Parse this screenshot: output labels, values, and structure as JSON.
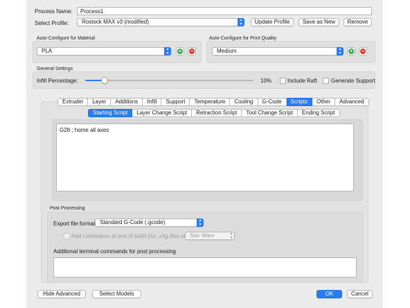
{
  "header": {
    "process_name_label": "Process Name:",
    "process_name_value": "Process1",
    "select_profile_label": "Select Profile:",
    "profile_value": "Rostock MAX v3 (modified)",
    "update_profile": "Update Profile",
    "save_as_new": "Save as New",
    "remove": "Remove"
  },
  "material": {
    "title": "Auto-Configure for Material",
    "value": "PLA"
  },
  "quality": {
    "title": "Auto-Configure for Print Quality",
    "value": "Medium"
  },
  "general": {
    "title": "General Settings",
    "infill_label": "Infill Percentage:",
    "infill_value_text": "10%",
    "infill_fraction": 0.1,
    "include_raft": "Include Raft",
    "generate_support": "Generate Support"
  },
  "tabs": [
    "Extruder",
    "Layer",
    "Additions",
    "Infill",
    "Support",
    "Temperature",
    "Cooling",
    "G-Code",
    "Scripts",
    "Other",
    "Advanced"
  ],
  "active_tab": "Scripts",
  "subtabs": [
    "Starting Script",
    "Layer Change Script",
    "Retraction Script",
    "Tool Change Script",
    "Ending Script"
  ],
  "active_subtab": "Starting Script",
  "script_text": "G28 ; home all axes",
  "post": {
    "title": "Post Processing",
    "export_label": "Export file format",
    "export_value": "Standard G-Code (.gcode)",
    "celebration_label": "Add celebration at end of build (for .x3g files only)",
    "celebration_value": "Star Wars",
    "terminal_label": "Additional terminal commands for post processing",
    "terminal_value": ""
  },
  "footer": {
    "hide_advanced": "Hide Advanced",
    "select_models": "Select Models",
    "ok": "OK",
    "cancel": "Cancel"
  },
  "colors": {
    "accent": "#2a7cf6",
    "add": "#2eae4a",
    "remove": "#e23b30"
  }
}
